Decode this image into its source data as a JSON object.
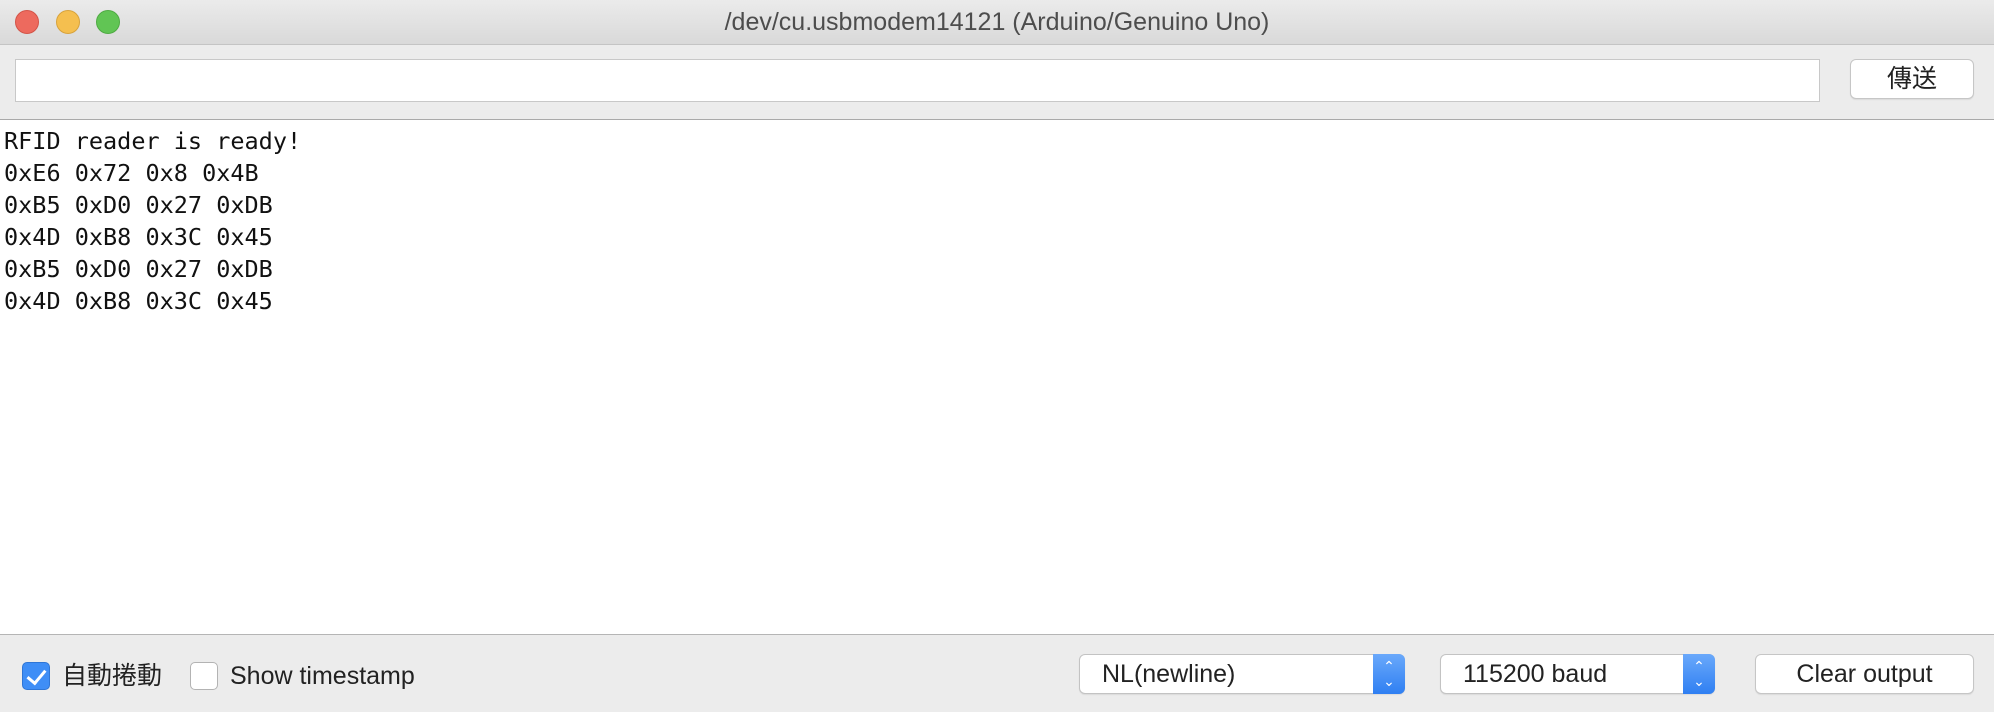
{
  "window": {
    "title": "/dev/cu.usbmodem14121 (Arduino/Genuino Uno)"
  },
  "send": {
    "input_value": "",
    "button_label": "傳送"
  },
  "output": {
    "lines": [
      "RFID reader is ready!",
      "0xE6 0x72 0x8 0x4B",
      "0xB5 0xD0 0x27 0xDB",
      "0x4D 0xB8 0x3C 0x45",
      "0xB5 0xD0 0x27 0xDB",
      "0x4D 0xB8 0x3C 0x45"
    ]
  },
  "footer": {
    "autoscroll_label": "自動捲動",
    "autoscroll_checked": true,
    "timestamp_label": "Show timestamp",
    "timestamp_checked": false,
    "line_ending": "NL(newline)",
    "baud_rate": "115200 baud",
    "clear_label": "Clear output"
  },
  "icons": {
    "close": "close-icon",
    "minimize": "minimize-icon",
    "zoom": "zoom-icon",
    "select_arrow": "chevron-updown-icon",
    "checkmark": "checkmark-icon"
  },
  "colors": {
    "accent": "#3f8ef6",
    "close": "#ed6a5e",
    "minimize": "#f5bf4f",
    "zoom": "#61c554"
  }
}
